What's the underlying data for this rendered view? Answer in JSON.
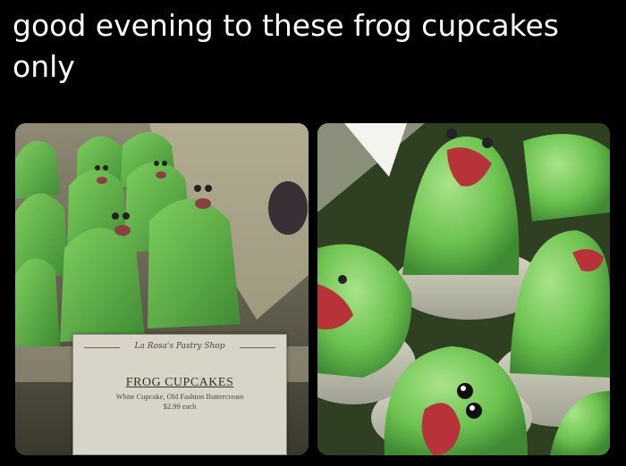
{
  "caption": "good evening to these frog cupcakes only",
  "sign": {
    "shop_name": "La Rosa's Pastry Shop",
    "title": "FROG CUPCAKES",
    "description": "White Cupcake, Old Fashion Buttercream",
    "price": "$2.99 each"
  },
  "colors": {
    "background": "#000000",
    "caption_text": "#ffffff",
    "frosting_green": "#6cc24f",
    "frosting_shadow": "#3f8a33",
    "mouth_red": "#b8323a",
    "sign_card": "#d9d4c8"
  }
}
